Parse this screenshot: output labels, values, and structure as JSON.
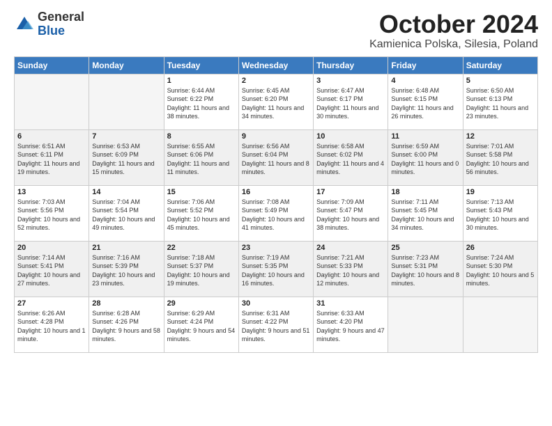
{
  "logo": {
    "general": "General",
    "blue": "Blue"
  },
  "title": {
    "month": "October 2024",
    "location": "Kamienica Polska, Silesia, Poland"
  },
  "weekdays": [
    "Sunday",
    "Monday",
    "Tuesday",
    "Wednesday",
    "Thursday",
    "Friday",
    "Saturday"
  ],
  "weeks": [
    [
      {
        "day": "",
        "info": ""
      },
      {
        "day": "",
        "info": ""
      },
      {
        "day": "1",
        "info": "Sunrise: 6:44 AM\nSunset: 6:22 PM\nDaylight: 11 hours and 38 minutes."
      },
      {
        "day": "2",
        "info": "Sunrise: 6:45 AM\nSunset: 6:20 PM\nDaylight: 11 hours and 34 minutes."
      },
      {
        "day": "3",
        "info": "Sunrise: 6:47 AM\nSunset: 6:17 PM\nDaylight: 11 hours and 30 minutes."
      },
      {
        "day": "4",
        "info": "Sunrise: 6:48 AM\nSunset: 6:15 PM\nDaylight: 11 hours and 26 minutes."
      },
      {
        "day": "5",
        "info": "Sunrise: 6:50 AM\nSunset: 6:13 PM\nDaylight: 11 hours and 23 minutes."
      }
    ],
    [
      {
        "day": "6",
        "info": "Sunrise: 6:51 AM\nSunset: 6:11 PM\nDaylight: 11 hours and 19 minutes."
      },
      {
        "day": "7",
        "info": "Sunrise: 6:53 AM\nSunset: 6:09 PM\nDaylight: 11 hours and 15 minutes."
      },
      {
        "day": "8",
        "info": "Sunrise: 6:55 AM\nSunset: 6:06 PM\nDaylight: 11 hours and 11 minutes."
      },
      {
        "day": "9",
        "info": "Sunrise: 6:56 AM\nSunset: 6:04 PM\nDaylight: 11 hours and 8 minutes."
      },
      {
        "day": "10",
        "info": "Sunrise: 6:58 AM\nSunset: 6:02 PM\nDaylight: 11 hours and 4 minutes."
      },
      {
        "day": "11",
        "info": "Sunrise: 6:59 AM\nSunset: 6:00 PM\nDaylight: 11 hours and 0 minutes."
      },
      {
        "day": "12",
        "info": "Sunrise: 7:01 AM\nSunset: 5:58 PM\nDaylight: 10 hours and 56 minutes."
      }
    ],
    [
      {
        "day": "13",
        "info": "Sunrise: 7:03 AM\nSunset: 5:56 PM\nDaylight: 10 hours and 52 minutes."
      },
      {
        "day": "14",
        "info": "Sunrise: 7:04 AM\nSunset: 5:54 PM\nDaylight: 10 hours and 49 minutes."
      },
      {
        "day": "15",
        "info": "Sunrise: 7:06 AM\nSunset: 5:52 PM\nDaylight: 10 hours and 45 minutes."
      },
      {
        "day": "16",
        "info": "Sunrise: 7:08 AM\nSunset: 5:49 PM\nDaylight: 10 hours and 41 minutes."
      },
      {
        "day": "17",
        "info": "Sunrise: 7:09 AM\nSunset: 5:47 PM\nDaylight: 10 hours and 38 minutes."
      },
      {
        "day": "18",
        "info": "Sunrise: 7:11 AM\nSunset: 5:45 PM\nDaylight: 10 hours and 34 minutes."
      },
      {
        "day": "19",
        "info": "Sunrise: 7:13 AM\nSunset: 5:43 PM\nDaylight: 10 hours and 30 minutes."
      }
    ],
    [
      {
        "day": "20",
        "info": "Sunrise: 7:14 AM\nSunset: 5:41 PM\nDaylight: 10 hours and 27 minutes."
      },
      {
        "day": "21",
        "info": "Sunrise: 7:16 AM\nSunset: 5:39 PM\nDaylight: 10 hours and 23 minutes."
      },
      {
        "day": "22",
        "info": "Sunrise: 7:18 AM\nSunset: 5:37 PM\nDaylight: 10 hours and 19 minutes."
      },
      {
        "day": "23",
        "info": "Sunrise: 7:19 AM\nSunset: 5:35 PM\nDaylight: 10 hours and 16 minutes."
      },
      {
        "day": "24",
        "info": "Sunrise: 7:21 AM\nSunset: 5:33 PM\nDaylight: 10 hours and 12 minutes."
      },
      {
        "day": "25",
        "info": "Sunrise: 7:23 AM\nSunset: 5:31 PM\nDaylight: 10 hours and 8 minutes."
      },
      {
        "day": "26",
        "info": "Sunrise: 7:24 AM\nSunset: 5:30 PM\nDaylight: 10 hours and 5 minutes."
      }
    ],
    [
      {
        "day": "27",
        "info": "Sunrise: 6:26 AM\nSunset: 4:28 PM\nDaylight: 10 hours and 1 minute."
      },
      {
        "day": "28",
        "info": "Sunrise: 6:28 AM\nSunset: 4:26 PM\nDaylight: 9 hours and 58 minutes."
      },
      {
        "day": "29",
        "info": "Sunrise: 6:29 AM\nSunset: 4:24 PM\nDaylight: 9 hours and 54 minutes."
      },
      {
        "day": "30",
        "info": "Sunrise: 6:31 AM\nSunset: 4:22 PM\nDaylight: 9 hours and 51 minutes."
      },
      {
        "day": "31",
        "info": "Sunrise: 6:33 AM\nSunset: 4:20 PM\nDaylight: 9 hours and 47 minutes."
      },
      {
        "day": "",
        "info": ""
      },
      {
        "day": "",
        "info": ""
      }
    ]
  ]
}
